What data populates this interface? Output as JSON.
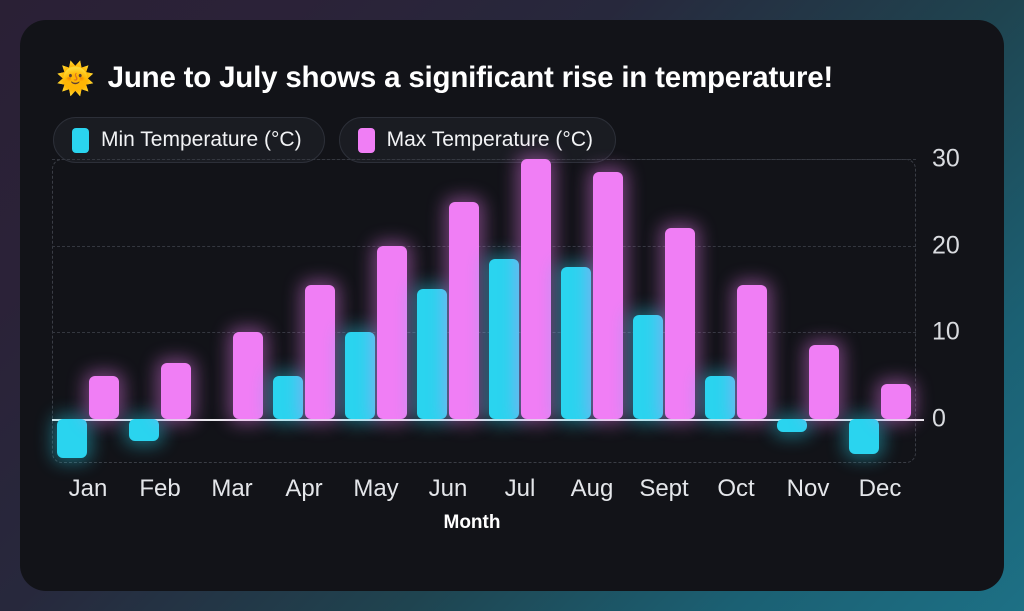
{
  "card": {
    "background_color": "#121318",
    "page_gradient_from": "#2a2035",
    "page_gradient_to": "#1d7085"
  },
  "header": {
    "icon": "sun-icon",
    "icon_glyph": "🌞",
    "title": "June to July shows a significant rise in temperature!"
  },
  "legend": {
    "position": "top-left",
    "items": [
      {
        "label": "Min Temperature (°C)",
        "color": "#2ad4ef"
      },
      {
        "label": "Max Temperature (°C)",
        "color": "#f07ef5"
      }
    ]
  },
  "chart_data": {
    "type": "bar",
    "title": "June to July shows a significant rise in temperature!",
    "xlabel": "Month",
    "ylabel": "",
    "ylim": [
      -5,
      30
    ],
    "yticks": [
      0,
      10,
      20,
      30
    ],
    "grid": true,
    "zero_line": true,
    "legend_position": "top-left",
    "categories": [
      "Jan",
      "Feb",
      "Mar",
      "Apr",
      "May",
      "Jun",
      "Jul",
      "Aug",
      "Sept",
      "Oct",
      "Nov",
      "Dec"
    ],
    "series": [
      {
        "name": "Min Temperature (°C)",
        "color": "#2ad4ef",
        "values": [
          -4.5,
          -2.5,
          0,
          5,
          10,
          15,
          18.5,
          17.5,
          12,
          5,
          -1.5,
          -4
        ]
      },
      {
        "name": "Max Temperature (°C)",
        "color": "#f07ef5",
        "values": [
          5,
          6.5,
          10,
          15.5,
          20,
          25,
          30,
          28.5,
          22,
          15.5,
          8.5,
          4
        ]
      }
    ]
  }
}
